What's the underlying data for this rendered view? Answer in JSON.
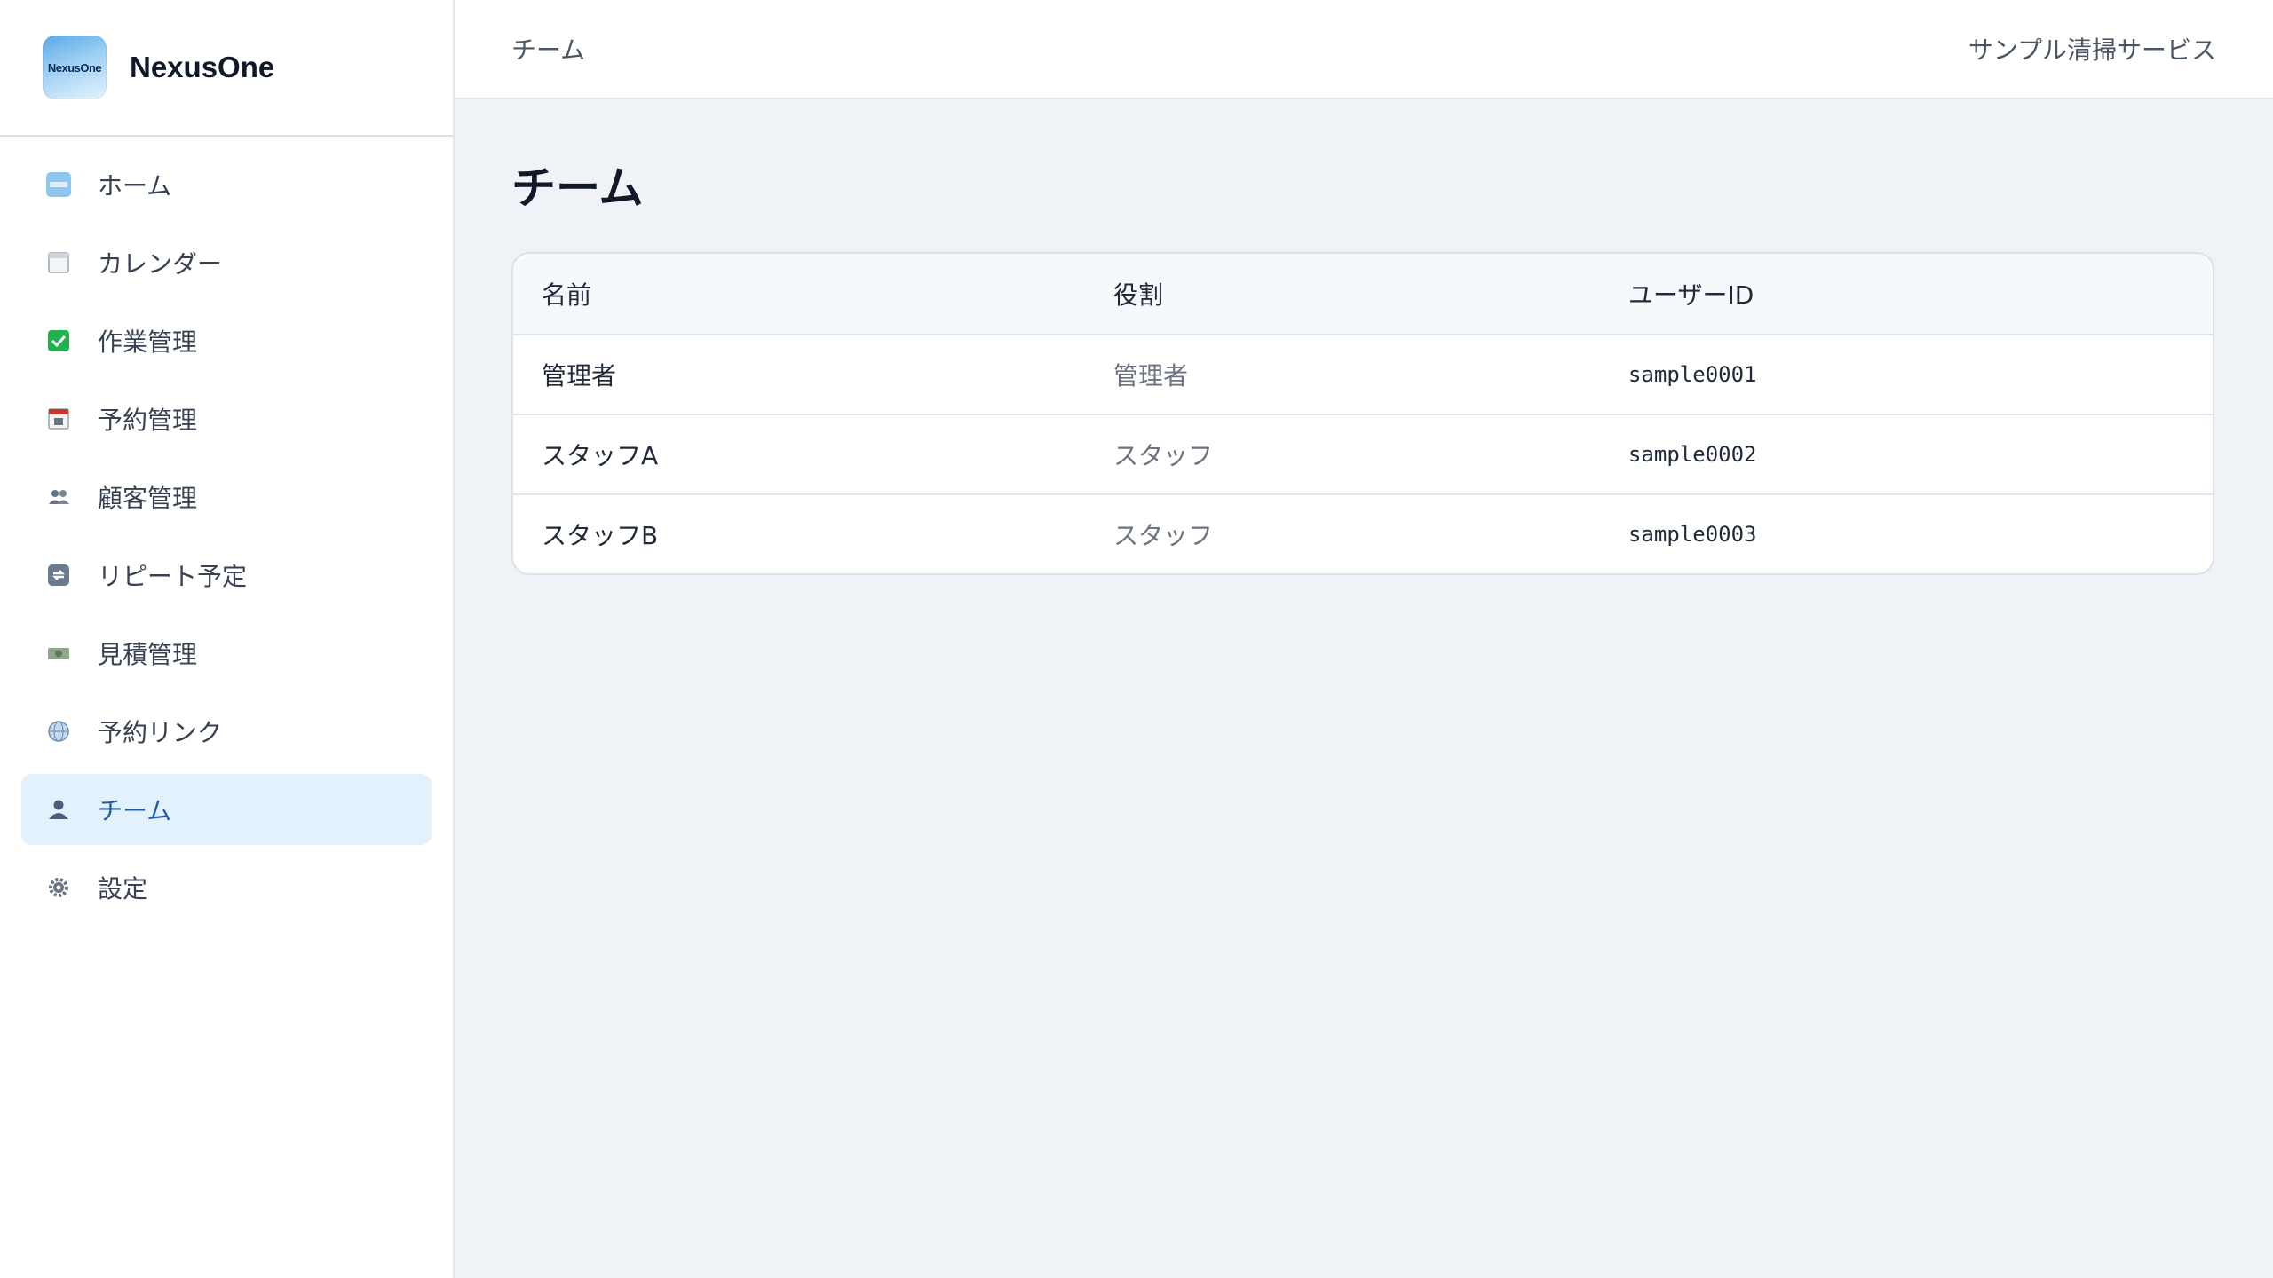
{
  "brand": {
    "name": "NexusOne",
    "logo_text": "NexusOne"
  },
  "sidebar": {
    "items": [
      {
        "label": "ホーム",
        "icon": "home-logo-icon"
      },
      {
        "label": "カレンダー",
        "icon": "calendar-icon"
      },
      {
        "label": "作業管理",
        "icon": "checkmark-icon"
      },
      {
        "label": "予約管理",
        "icon": "date-calendar-icon"
      },
      {
        "label": "顧客管理",
        "icon": "people-icon"
      },
      {
        "label": "リピート予定",
        "icon": "repeat-icon"
      },
      {
        "label": "見積管理",
        "icon": "money-icon"
      },
      {
        "label": "予約リンク",
        "icon": "globe-icon"
      },
      {
        "label": "チーム",
        "icon": "person-icon",
        "active": true
      },
      {
        "label": "設定",
        "icon": "gear-icon"
      }
    ]
  },
  "topbar": {
    "breadcrumb": "チーム",
    "company": "サンプル清掃サービス"
  },
  "main": {
    "title": "チーム",
    "table": {
      "headers": [
        "名前",
        "役割",
        "ユーザーID"
      ],
      "rows": [
        {
          "name": "管理者",
          "role": "管理者",
          "user_id": "sample0001"
        },
        {
          "name": "スタッフA",
          "role": "スタッフ",
          "user_id": "sample0002"
        },
        {
          "name": "スタッフB",
          "role": "スタッフ",
          "user_id": "sample0003"
        }
      ]
    }
  },
  "colors": {
    "accent": "#1e5aa8",
    "active_bg": "#e3f1fc",
    "page_bg": "#eff3f8"
  }
}
